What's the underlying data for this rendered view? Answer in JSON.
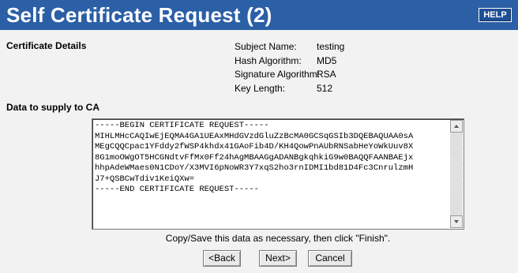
{
  "header": {
    "title": "Self Certificate Request (2)",
    "help_label": "HELP"
  },
  "certificate_details": {
    "heading": "Certificate Details",
    "fields": [
      {
        "label": "Subject Name:",
        "value": "testing"
      },
      {
        "label": "Hash Algorithm:",
        "value": "MD5"
      },
      {
        "label": "Signature Algorithm:",
        "value": "RSA"
      },
      {
        "label": "Key Length:",
        "value": "512"
      }
    ]
  },
  "ca_data": {
    "heading": "Data to supply to CA",
    "text": "-----BEGIN CERTIFICATE REQUEST-----\nMIHLMHcCAQIwEjEQMA4GA1UEAxMHdGVzdGluZzBcMA0GCSqGSIb3DQEBAQUAA0sA\nMEgCQQCpac1YFddy2fWSP4khdx41GAoFib4D/KH4QowPnAUbRNSabHeYoWkUuv8X\n8G1moOWgOT5HCGNdtvFfMx0Ff24hAgMBAAGgADANBgkqhkiG9w0BAQQFAANBAEjx\nhhpAdeWMaes0N1CDoY/X3MVI6pNoWR3Y7xqS2ho3rnIDMI1bd81D4Fc3CnrulzmH\nJ7+QSBCwTdiv1KeiQXw=\n-----END CERTIFICATE REQUEST-----"
  },
  "footer": {
    "hint": "Copy/Save this data as necessary, then click \"Finish\".",
    "back_label": "<Back",
    "next_label": "Next>",
    "cancel_label": "Cancel"
  },
  "colors": {
    "title_bar": "#2b5fa6",
    "panel_background": "#f2f2f2"
  }
}
